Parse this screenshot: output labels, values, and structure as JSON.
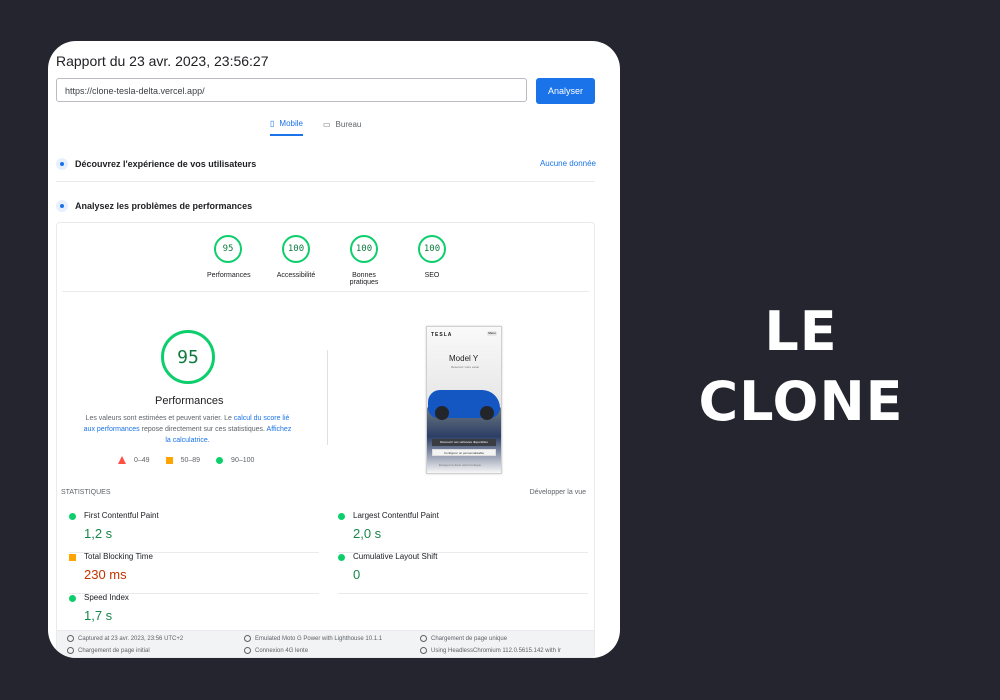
{
  "report": {
    "title": "Rapport du 23 avr. 2023, 23:56:27",
    "url": "https://clone-tesla-delta.vercel.app/",
    "analyze": "Analyser"
  },
  "tabs": {
    "mobile": "Mobile",
    "desktop": "Bureau"
  },
  "sections": {
    "experience": "Découvrez l'expérience de vos utilisateurs",
    "no_data": "Aucune donnée",
    "performance": "Analysez les problèmes de performances"
  },
  "scores": [
    {
      "label": "Performances",
      "value": "95"
    },
    {
      "label": "Accessibilité",
      "value": "100"
    },
    {
      "label": "Bonnes pratiques",
      "value": "100"
    },
    {
      "label": "SEO",
      "value": "100"
    }
  ],
  "main_score": {
    "value": "95",
    "title": "Performances",
    "description_before": "Les valeurs sont estimées et peuvent varier. Le ",
    "description_link_1": "calcul du score lié aux performances",
    "description_middle": " repose directement sur ces statistiques. ",
    "description_link_2": "Affichez la calculatrice."
  },
  "legend": [
    "0–49",
    "50–89",
    "90–100"
  ],
  "preview": {
    "brand": "TESLA",
    "menu": "Menu",
    "model": "Model Y",
    "subtext": "Réservez votre essai",
    "button_primary": "Découvrir nos véhicules disponibles",
    "button_secondary": "Configurer un personnalisable",
    "demo": "Essayez-le dans notre boutique"
  },
  "stats": {
    "heading": "STATISTIQUES",
    "expand": "Développer la vue",
    "metrics": [
      {
        "name": "First Contentful Paint",
        "value": "1,2 s"
      },
      {
        "name": "Largest Contentful Paint",
        "value": "2,0 s"
      },
      {
        "name": "Total Blocking Time",
        "value": "230 ms"
      },
      {
        "name": "Cumulative Layout Shift",
        "value": "0"
      },
      {
        "name": "Speed Index",
        "value": "1,7 s"
      }
    ]
  },
  "footer": {
    "captured": "Captured at 23 avr. 2023, 23:56 UTC+2",
    "emulated": "Emulated Moto G Power with Lighthouse 10.1.1",
    "single_load": "Chargement de page unique",
    "initial_load": "Chargement de page initial",
    "connection": "Connexion 4G lente",
    "browser": "Using HeadlessChromium 112.0.5615.142 with lr"
  },
  "side_text": {
    "line1": "LE",
    "line2": "CLONE"
  },
  "colors": {
    "background": "#25252f",
    "accent": "#1a73e8",
    "pass": "#0cce6b",
    "average": "#ffa400",
    "fail": "#ff4e42"
  }
}
